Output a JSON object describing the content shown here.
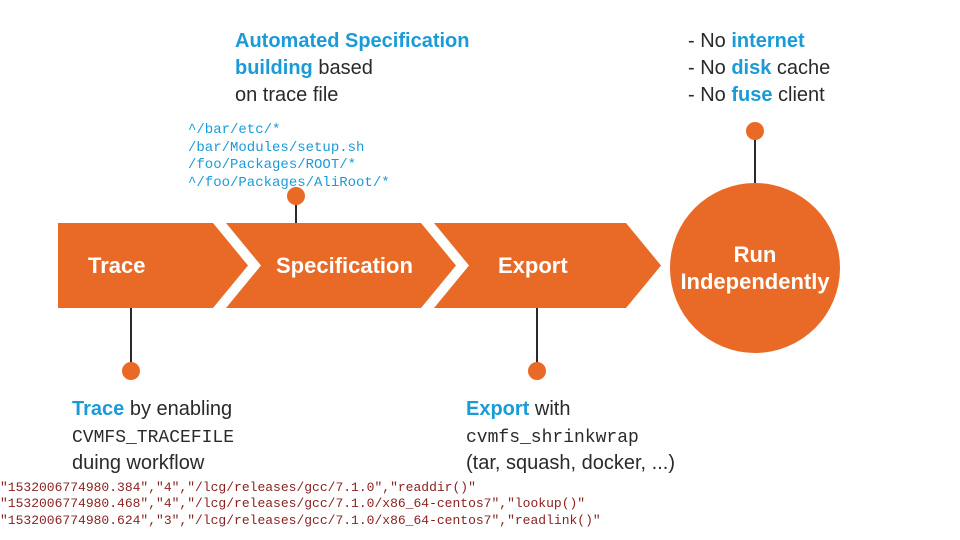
{
  "colors": {
    "accent": "#e86a26",
    "link": "#1a9bd8",
    "text": "#2a2a2a",
    "log": "#8a1f1f"
  },
  "spec_ann": {
    "l1a": "Automated Specification",
    "l2a": "building",
    "l2b": " based",
    "l3": "on trace file"
  },
  "run_ann": {
    "prefix": "- No ",
    "w1": "internet",
    "l2a": "- No ",
    "w2": "disk",
    "l2b": " cache",
    "l3a": "- No ",
    "w3": "fuse",
    "l3b": " client"
  },
  "pathlist": "^/bar/etc/*\n/bar/Modules/setup.sh\n/foo/Packages/ROOT/*\n^/foo/Packages/AliRoot/*",
  "chevrons": {
    "trace": "Trace",
    "spec": "Specification",
    "export": "Export"
  },
  "circle_l1": "Run",
  "circle_l2": "Independently",
  "trace_ann": {
    "w": "Trace",
    "l1b": " by enabling",
    "code": "CVMFS_TRACEFILE",
    "l3": "duing workflow"
  },
  "export_ann": {
    "w": "Export",
    "l1b": " with",
    "code": "cvmfs_shrinkwrap",
    "l3": "(tar, squash, docker, ...)"
  },
  "trace_log": "\"1532006774980.384\",\"4\",\"/lcg/releases/gcc/7.1.0\",\"readdir()\"\n\"1532006774980.468\",\"4\",\"/lcg/releases/gcc/7.1.0/x86_64-centos7\",\"lookup()\"\n\"1532006774980.624\",\"3\",\"/lcg/releases/gcc/7.1.0/x86_64-centos7\",\"readlink()\""
}
